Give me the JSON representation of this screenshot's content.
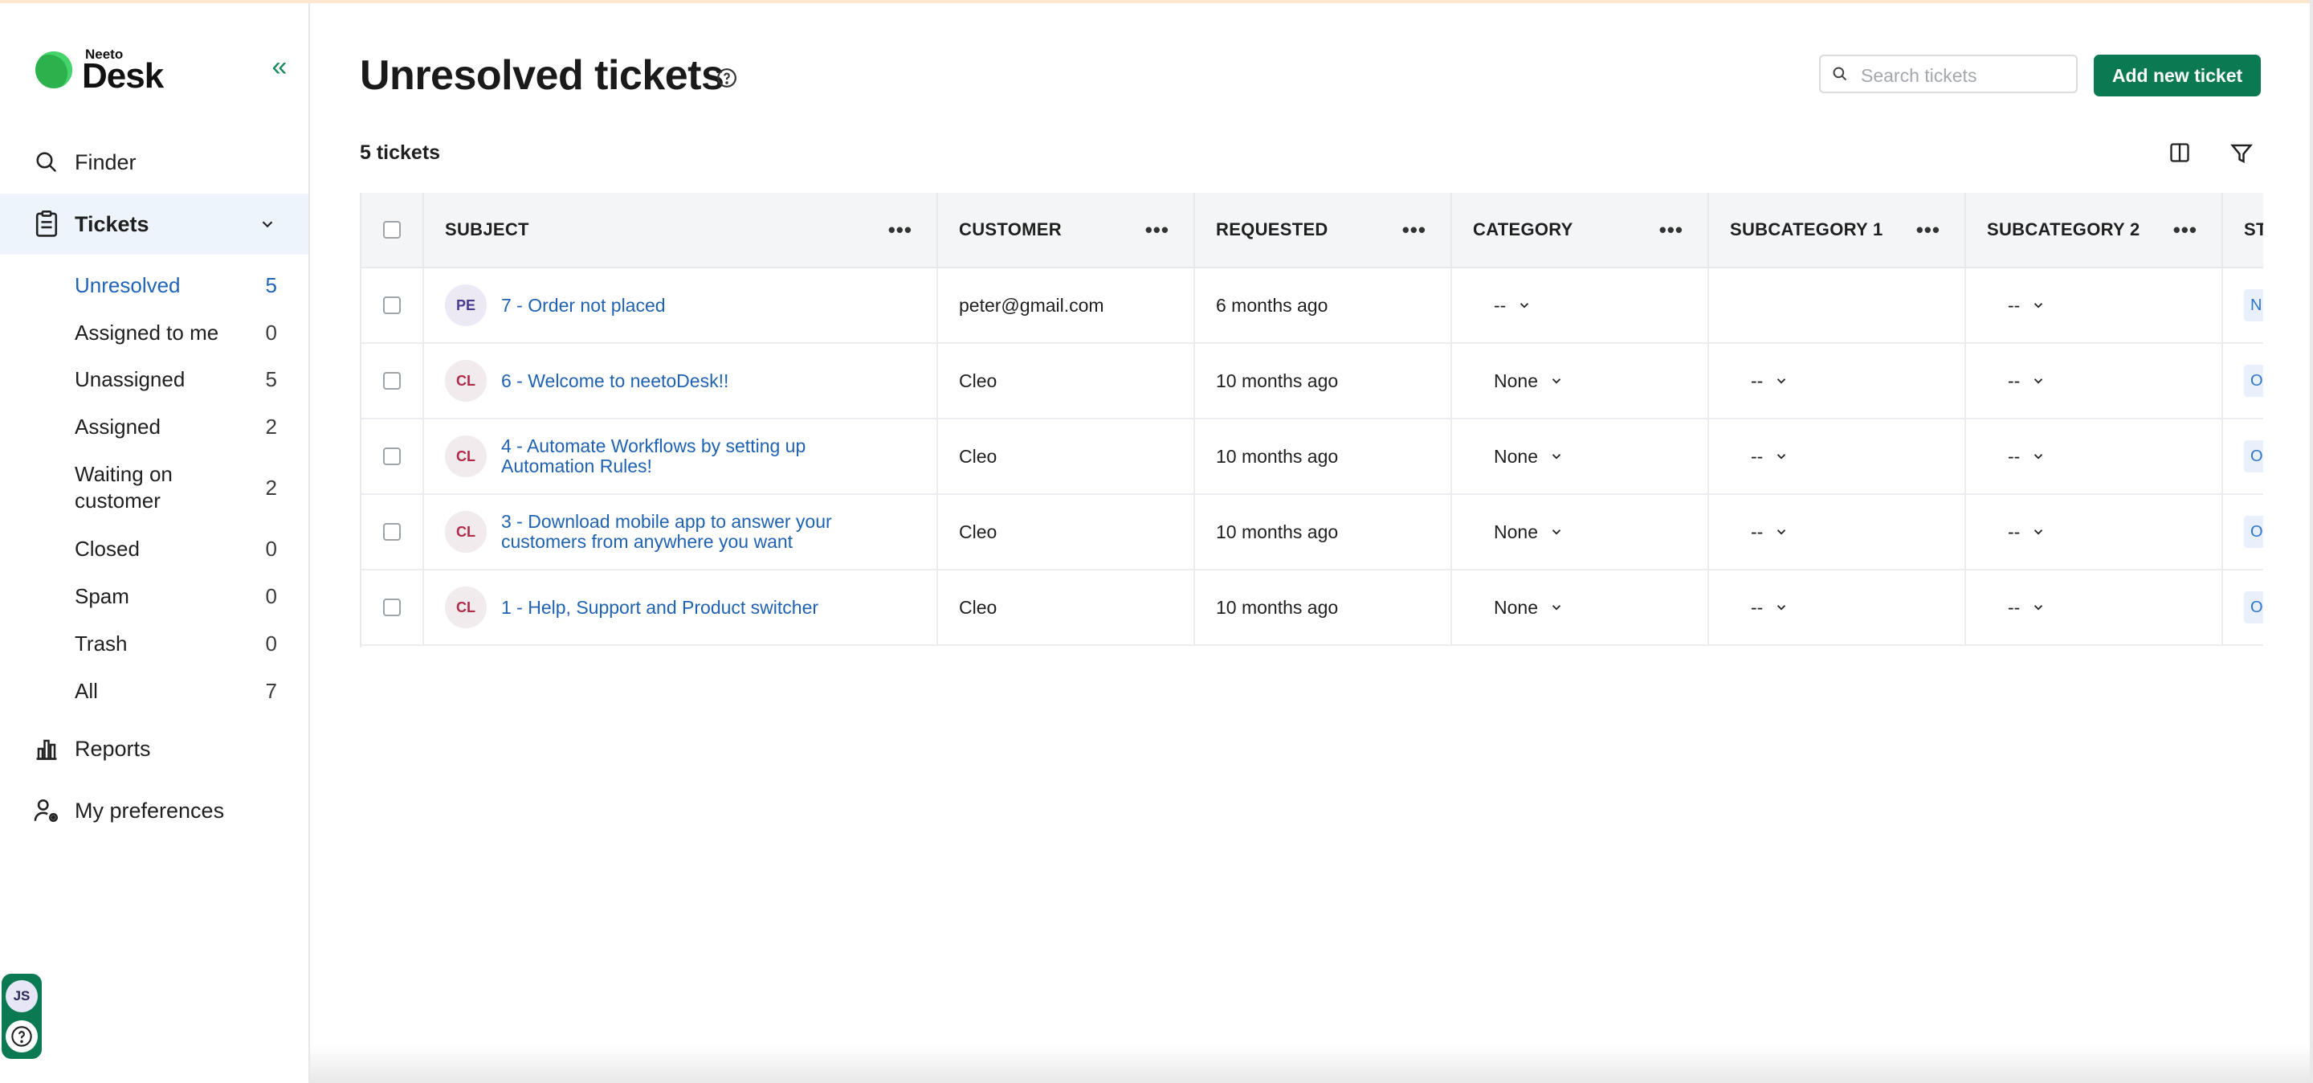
{
  "brand": {
    "small": "Neeto",
    "big": "Desk"
  },
  "nav": {
    "finder": "Finder",
    "tickets": "Tickets",
    "reports": "Reports",
    "preferences": "My preferences"
  },
  "ticket_views": [
    {
      "label": "Unresolved",
      "count": "5"
    },
    {
      "label": "Assigned to me",
      "count": "0"
    },
    {
      "label": "Unassigned",
      "count": "5"
    },
    {
      "label": "Assigned",
      "count": "2"
    },
    {
      "label": "Waiting on customer",
      "count": "2"
    },
    {
      "label": "Closed",
      "count": "0"
    },
    {
      "label": "Spam",
      "count": "0"
    },
    {
      "label": "Trash",
      "count": "0"
    },
    {
      "label": "All",
      "count": "7"
    }
  ],
  "user": {
    "initials": "JS"
  },
  "page": {
    "title": "Unresolved tickets",
    "count_label": "5 tickets",
    "search_placeholder": "Search tickets",
    "add_button": "Add new ticket"
  },
  "columns": [
    "SUBJECT",
    "CUSTOMER",
    "REQUESTED",
    "CATEGORY",
    "SUBCATEGORY 1",
    "SUBCATEGORY 2",
    "ST"
  ],
  "rows": [
    {
      "initials": "PE",
      "subject": "7 - Order not placed",
      "customer": "peter@gmail.com",
      "requested": "6 months ago",
      "category": "--",
      "sub1": "",
      "sub2": "--",
      "status": "N"
    },
    {
      "initials": "CL",
      "subject": "6 - Welcome to neetoDesk!!",
      "customer": "Cleo",
      "requested": "10 months ago",
      "category": "None",
      "sub1": "--",
      "sub2": "--",
      "status": "O"
    },
    {
      "initials": "CL",
      "subject": "4 - Automate Workflows by setting up Automation Rules!",
      "customer": "Cleo",
      "requested": "10 months ago",
      "category": "None",
      "sub1": "--",
      "sub2": "--",
      "status": "O"
    },
    {
      "initials": "CL",
      "subject": "3 - Download mobile app to answer your customers from anywhere you want",
      "customer": "Cleo",
      "requested": "10 months ago",
      "category": "None",
      "sub1": "--",
      "sub2": "--",
      "status": "O"
    },
    {
      "initials": "CL",
      "subject": "1 - Help, Support and Product switcher",
      "customer": "Cleo",
      "requested": "10 months ago",
      "category": "None",
      "sub1": "--",
      "sub2": "--",
      "status": "O"
    }
  ],
  "colors": {
    "brand_green": "#0b7a52",
    "link_blue": "#1f62b2",
    "active_bg": "#eef4fb"
  }
}
